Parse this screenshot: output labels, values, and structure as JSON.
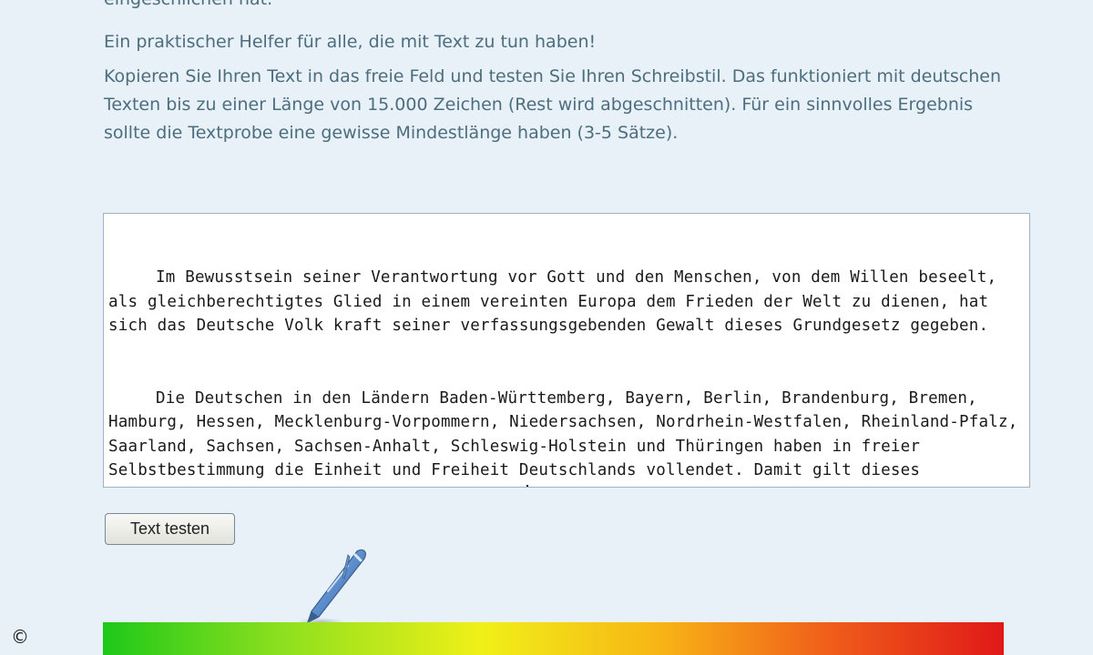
{
  "intro": {
    "clipped_line": "eingeschlichen hat.",
    "line_1": "Ein praktischer Helfer für alle, die mit Text zu tun haben!",
    "paragraph_2": "Kopieren Sie Ihren Text in das freie Feld und testen Sie Ihren Schreibstil. Das funktioniert mit deutschen Texten bis zu einer Länge von 15.000 Zeichen (Rest wird abgeschnitten). Für ein sinnvolles Ergebnis sollte die Textprobe eine gewisse Mindestlänge haben (3-5 Sätze)."
  },
  "textarea": {
    "paragraphs": [
      "Im Bewusstsein seiner Verantwortung vor Gott und den Menschen, von dem Willen beseelt, als gleichberechtigtes Glied in einem vereinten Europa dem Frieden der Welt zu dienen, hat sich das Deutsche Volk kraft seiner verfassungsgebenden Gewalt dieses Grundgesetz gegeben.",
      "Die Deutschen in den Ländern Baden-Württemberg, Bayern, Berlin, Brandenburg, Bremen, Hamburg, Hessen, Mecklenburg-Vorpommern, Niedersachsen, Nordrhein-Westfalen, Rheinland-Pfalz, Saarland, Sachsen, Sachsen-Anhalt, Schleswig-Holstein und Thüringen haben in freier Selbstbestimmung die Einheit und Freiheit Deutschlands vollendet. Damit gilt dieses Grundgesetz für das gesamte Deutsche Volk."
    ]
  },
  "button": {
    "label": "Text testen"
  },
  "icons": {
    "pen": "pen-icon",
    "copyright": "copyright-icon",
    "copyright_glyph": "©"
  },
  "scale": {
    "colors": [
      "#1ec81a",
      "#8ee01e",
      "#f0f018",
      "#f8b416",
      "#f0601a",
      "#e01818"
    ]
  }
}
